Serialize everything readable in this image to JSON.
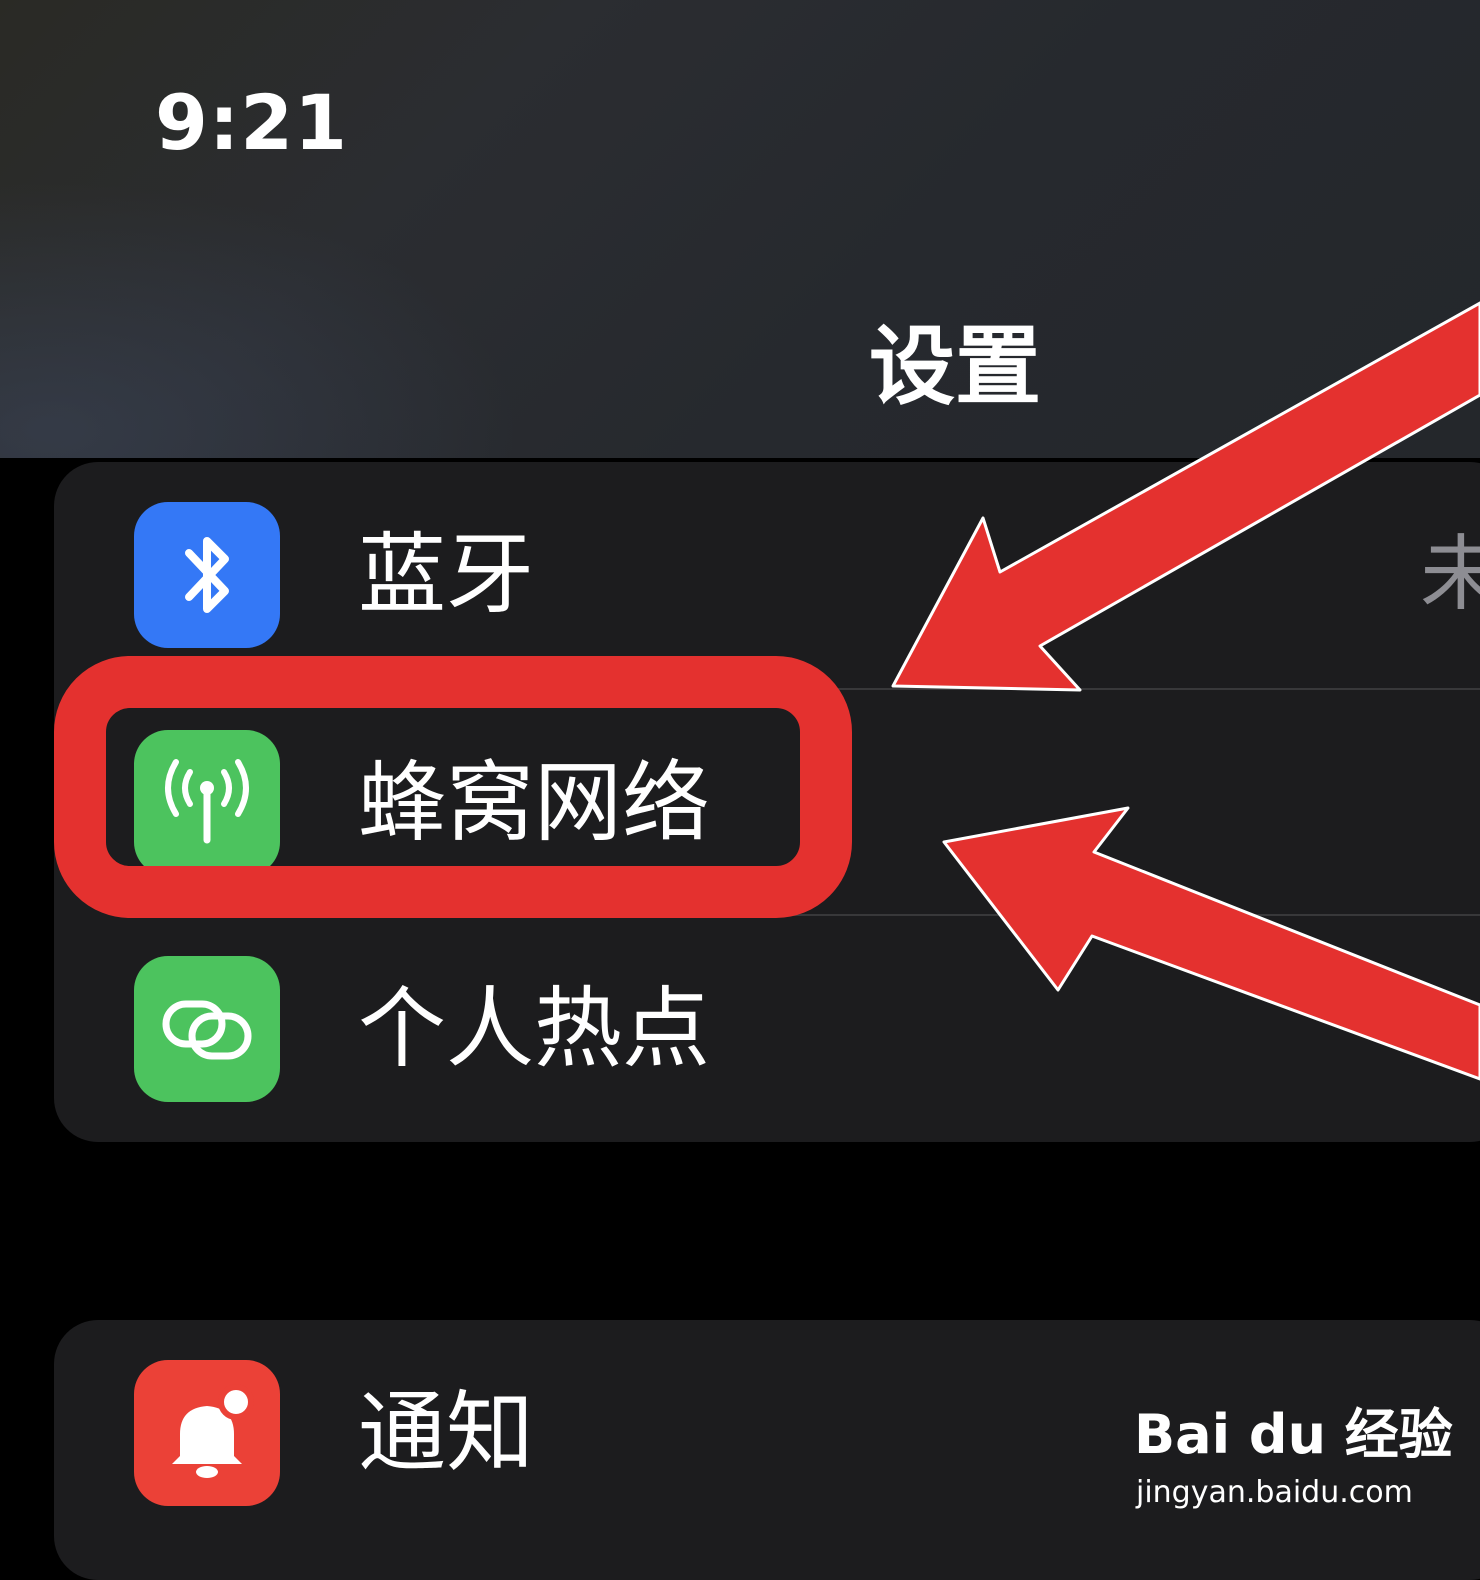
{
  "status_bar": {
    "time": "9:21"
  },
  "nav": {
    "title": "设置"
  },
  "groups": {
    "connectivity": [
      {
        "name": "bluetooth",
        "label": "蓝牙",
        "value": "未",
        "icon": "bluetooth-icon",
        "icon_color": "#3478f6"
      },
      {
        "name": "cellular",
        "label": "蜂窝网络",
        "icon": "antenna-icon",
        "icon_color": "#4cc35e"
      },
      {
        "name": "hotspot",
        "label": "个人热点",
        "icon": "link-icon",
        "icon_color": "#4cc35e"
      }
    ],
    "system": [
      {
        "name": "notifications",
        "label": "通知",
        "icon": "bell-badge-icon",
        "icon_color": "#eb4137"
      }
    ]
  },
  "annotation": {
    "highlight_color": "#e4312f",
    "highlighted_item": "蜂窝网络"
  },
  "watermark": {
    "logo": "Bai du 经验",
    "url": "jingyan.baidu.com"
  }
}
